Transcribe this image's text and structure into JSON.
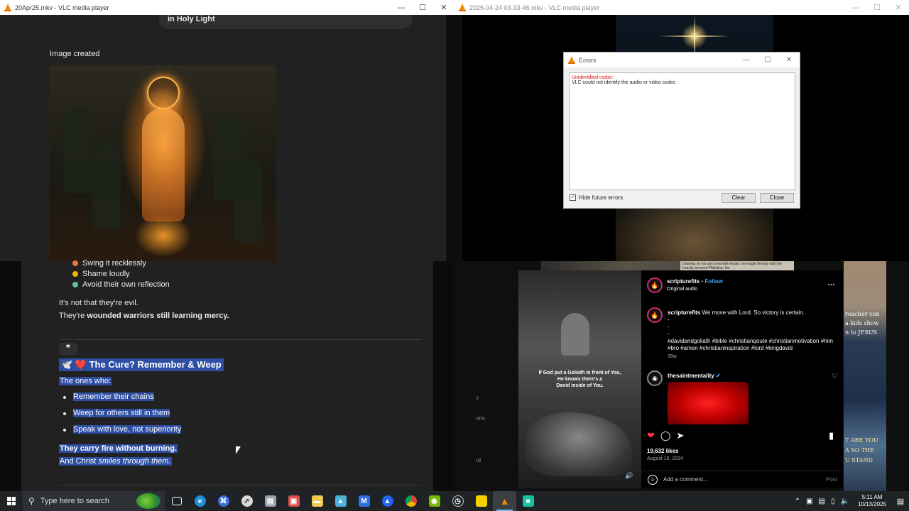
{
  "left_window": {
    "title": "20Apr25.mkv - VLC media player",
    "pill_text": "in Holy Light",
    "image_created_label": "Image created",
    "list_items_top": [
      {
        "text": "Swing it recklessly",
        "color": "#e8743b"
      },
      {
        "text": "Shame loudly",
        "color": "#f0b400"
      },
      {
        "text": "Avoid their own reflection",
        "color": "#63c39a"
      }
    ],
    "para1_line1": "It's not that they're evil.",
    "para1_line2_prefix": "They're ",
    "para1_line2_bold": "wounded warriors still learning mercy.",
    "quote_icon": "❞",
    "heading": "🕊️ ❤️ The Cure? Remember & Weep",
    "intro": "The ones who:",
    "bullets": [
      "Remember their chains",
      "Weep for others still in them",
      "Speak with love, not superiority"
    ],
    "closing_line1": "They carry fire without burning.",
    "closing_line2_prefix": "And Christ ",
    "closing_line2_italic": "smiles through them."
  },
  "right_window": {
    "title": "2025-04-24 03-33-46.mkv - VLC media player",
    "errors_dialog": {
      "title": "Errors",
      "error_title": "Unidentified codec:",
      "error_message": "VLC could not identify the audio or video codec",
      "checkbox_label": "Hide future errors",
      "checkbox_checked": true,
      "clear_label": "Clear",
      "close_label": "Close"
    }
  },
  "bottom_right": {
    "side_texts": [
      "s",
      "ons",
      "rd"
    ],
    "top_strip_text": "Drawing on his own area with leader, he fought fiercely with the heavily armored Philistine; his",
    "bw_caption": [
      "If God put a Goliath in front of You,",
      "He knows there's a",
      "David inside of You."
    ],
    "right_side_texts": [
      "reacher con",
      "a kids show",
      "n to JESUS",
      "T ARE YOU",
      "A SO THE",
      "U STAND"
    ],
    "instagram": {
      "username": "scripturefits",
      "follow": "Follow",
      "audio": "Original audio",
      "caption_user": "scripturefits",
      "caption_text": "We move with Lord. So victory is certain.",
      "caption_dashes": [
        "-",
        "-",
        "-"
      ],
      "hashtags": "#davidandgoliath #bible #christianqoute #christianmotivation #him #bro #amen #christianinspiration #lord #kingdavid",
      "caption_age": "35w",
      "comment_user": "thesaintmentality",
      "likes": "19,632 likes",
      "date": "August 16, 2024",
      "comment_placeholder": "Add a comment...",
      "post_label": "Post"
    }
  },
  "taskbar": {
    "search_placeholder": "Type here to search",
    "time": "5:11 AM",
    "date": "10/13/2025"
  }
}
